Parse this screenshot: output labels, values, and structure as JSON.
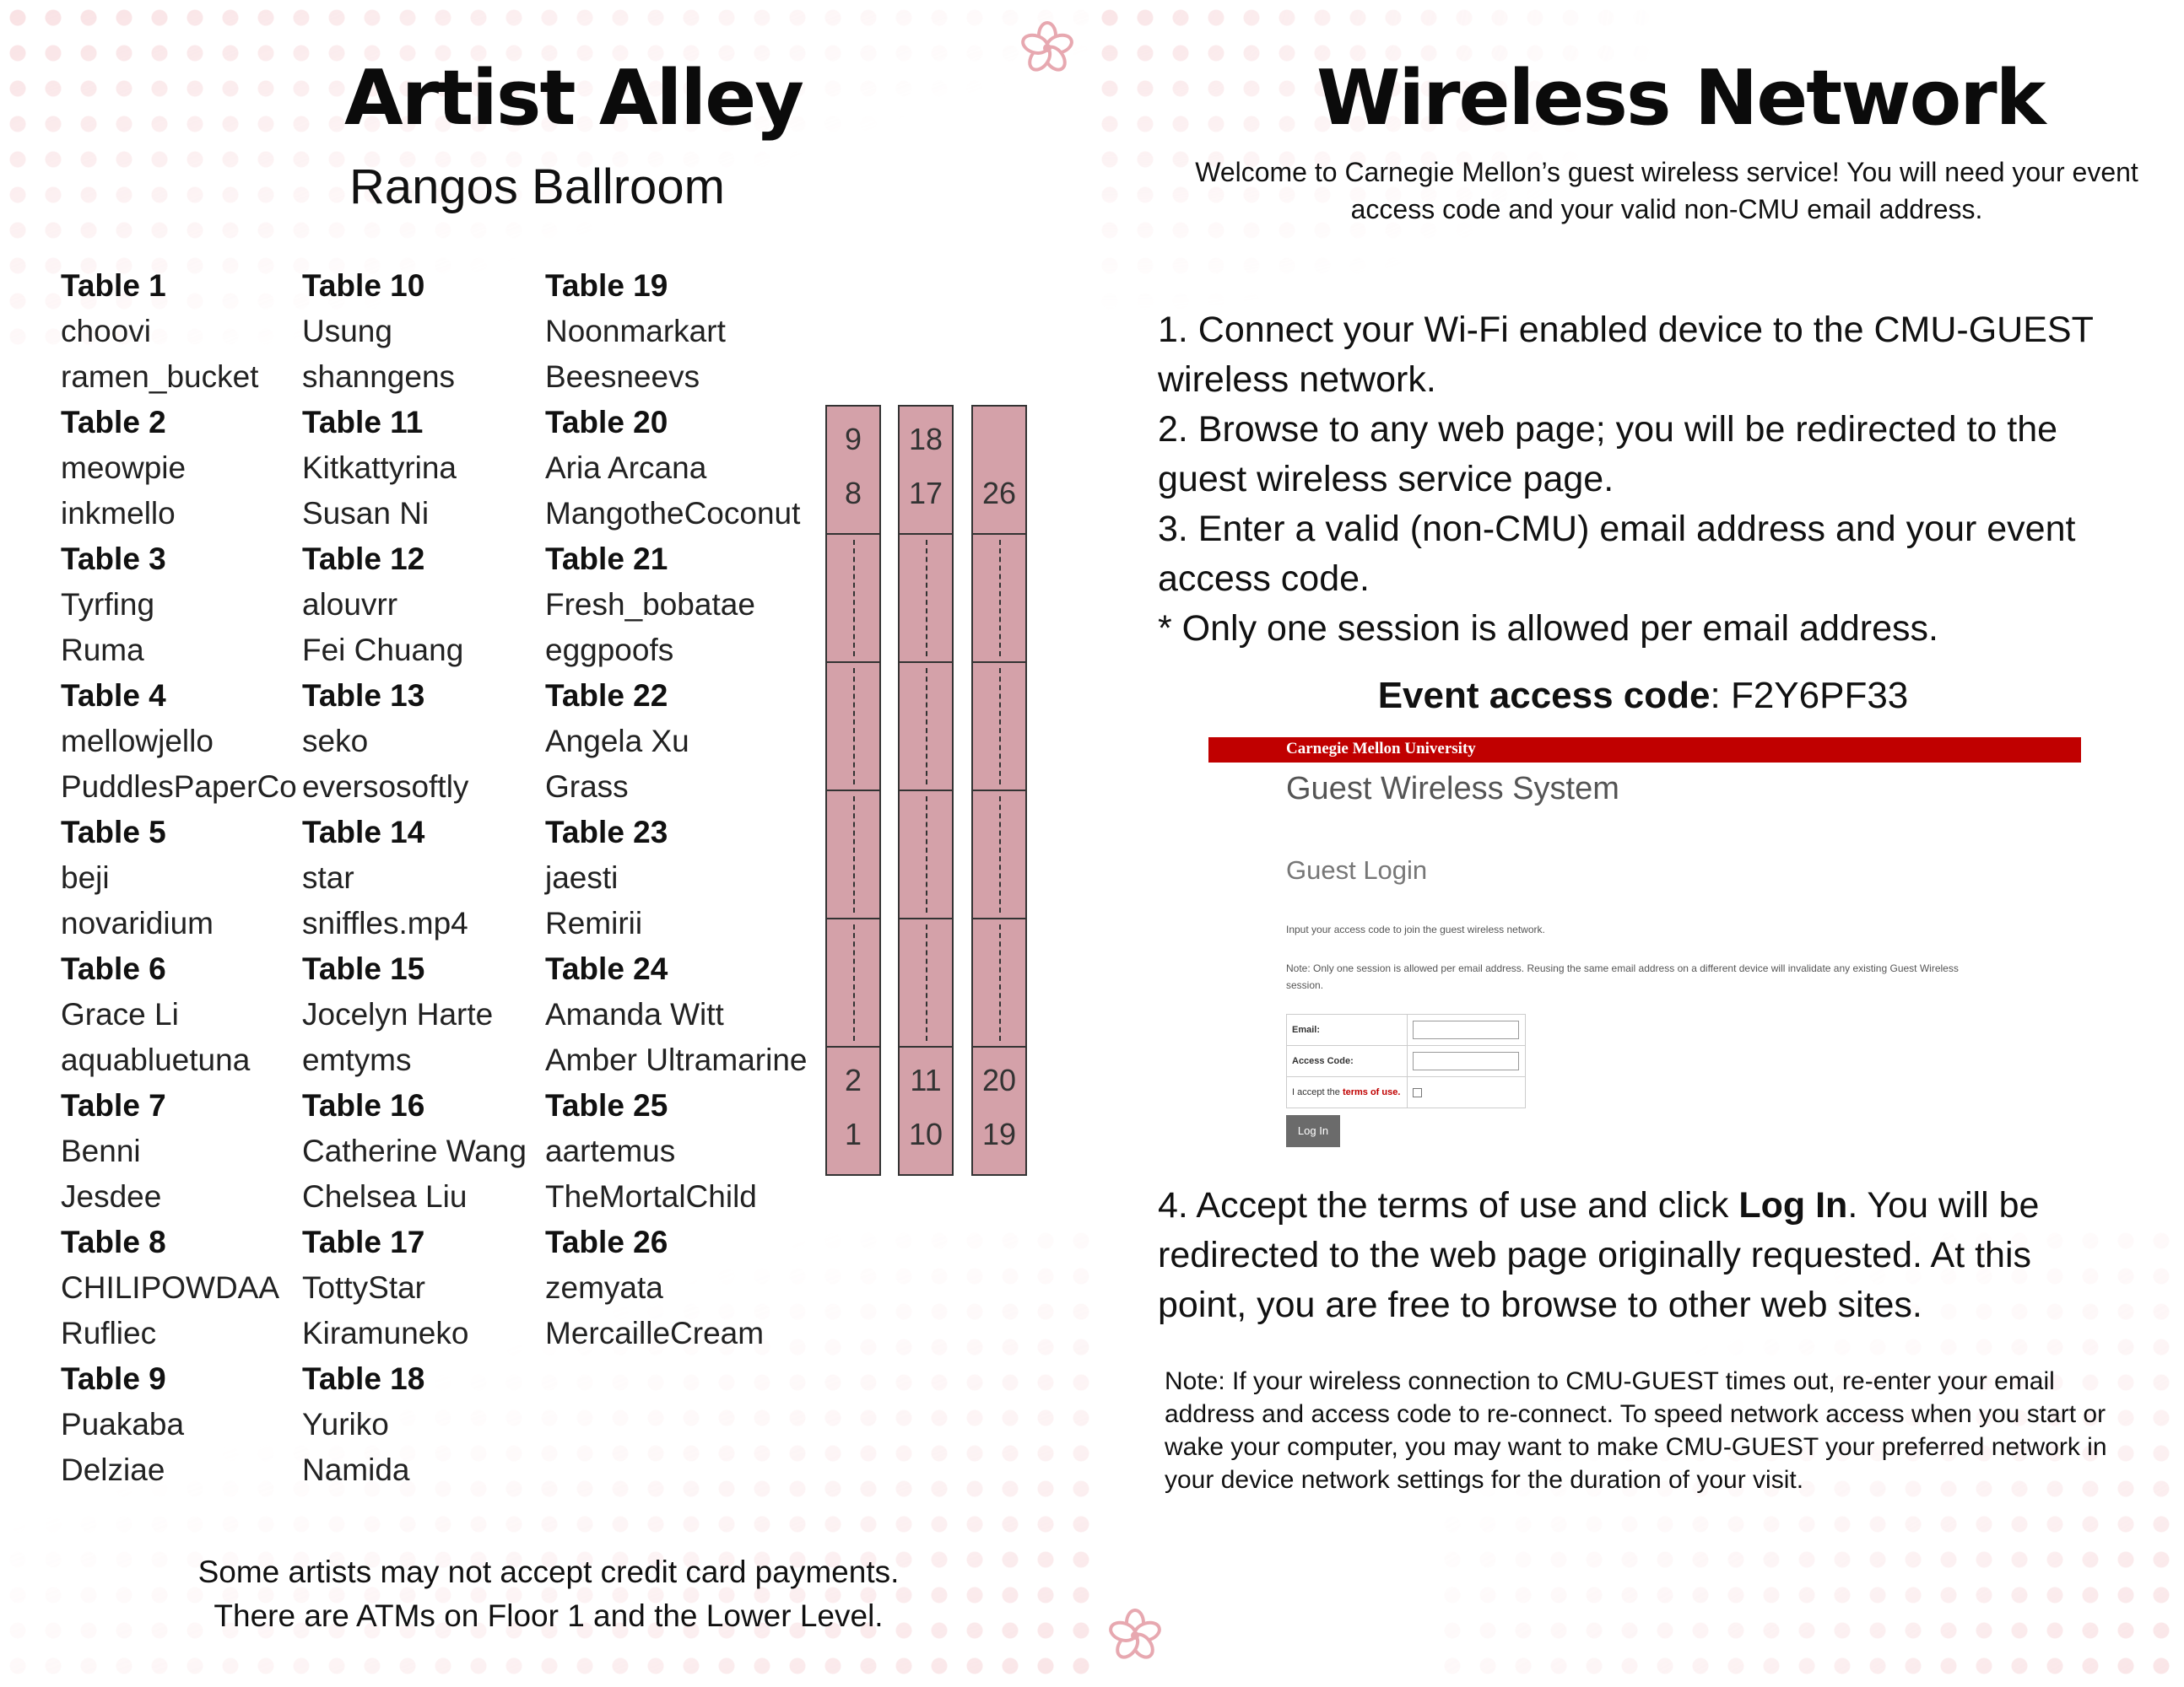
{
  "left": {
    "title": "Artist Alley",
    "subtitle": "Rangos Ballroom",
    "columns": [
      [
        {
          "label": "Table 1",
          "head": true
        },
        {
          "label": "choovi"
        },
        {
          "label": "ramen_bucket"
        },
        {
          "label": "Table 2",
          "head": true
        },
        {
          "label": "meowpie"
        },
        {
          "label": "inkmello"
        },
        {
          "label": "Table 3",
          "head": true
        },
        {
          "label": "Tyrfing"
        },
        {
          "label": "Ruma"
        },
        {
          "label": "Table 4",
          "head": true
        },
        {
          "label": "mellowjello"
        },
        {
          "label": "PuddlesPaperCo"
        },
        {
          "label": "Table 5",
          "head": true
        },
        {
          "label": "beji"
        },
        {
          "label": "novaridium"
        },
        {
          "label": "Table 6",
          "head": true
        },
        {
          "label": "Grace Li"
        },
        {
          "label": "aquabluetuna"
        },
        {
          "label": "Table 7",
          "head": true
        },
        {
          "label": "Benni"
        },
        {
          "label": "Jesdee"
        },
        {
          "label": "Table 8",
          "head": true
        },
        {
          "label": "CHILIPOWDAA"
        },
        {
          "label": "Rufliec"
        },
        {
          "label": "Table 9",
          "head": true
        },
        {
          "label": "Puakaba"
        },
        {
          "label": "Delziae"
        }
      ],
      [
        {
          "label": "Table 10",
          "head": true
        },
        {
          "label": "Usung"
        },
        {
          "label": "shanngens"
        },
        {
          "label": "Table 11",
          "head": true
        },
        {
          "label": "Kitkattyrina"
        },
        {
          "label": "Susan Ni"
        },
        {
          "label": "Table 12",
          "head": true
        },
        {
          "label": "alouvrr"
        },
        {
          "label": "Fei Chuang"
        },
        {
          "label": "Table 13",
          "head": true
        },
        {
          "label": "seko"
        },
        {
          "label": "eversosoftly"
        },
        {
          "label": "Table 14",
          "head": true
        },
        {
          "label": "star"
        },
        {
          "label": "sniffles.mp4"
        },
        {
          "label": "Table 15",
          "head": true
        },
        {
          "label": "Jocelyn Harte"
        },
        {
          "label": "emtyms"
        },
        {
          "label": "Table 16",
          "head": true
        },
        {
          "label": "Catherine Wang"
        },
        {
          "label": "Chelsea Liu"
        },
        {
          "label": "Table 17",
          "head": true
        },
        {
          "label": "TottyStar"
        },
        {
          "label": "Kiramuneko"
        },
        {
          "label": "Table 18",
          "head": true
        },
        {
          "label": "Yuriko"
        },
        {
          "label": "Namida"
        }
      ],
      [
        {
          "label": "Table 19",
          "head": true
        },
        {
          "label": "Noonmarkart"
        },
        {
          "label": "Beesneevs"
        },
        {
          "label": "Table 20",
          "head": true
        },
        {
          "label": "Aria Arcana"
        },
        {
          "label": "MangotheCoconut"
        },
        {
          "label": "Table 21",
          "head": true
        },
        {
          "label": "Fresh_bobatae"
        },
        {
          "label": "eggpoofs"
        },
        {
          "label": "Table 22",
          "head": true
        },
        {
          "label": "Angela Xu"
        },
        {
          "label": "Grass"
        },
        {
          "label": "Table 23",
          "head": true
        },
        {
          "label": "jaesti"
        },
        {
          "label": "Remirii"
        },
        {
          "label": "Table 24",
          "head": true
        },
        {
          "label": "Amanda Witt"
        },
        {
          "label": "Amber Ultramarine"
        },
        {
          "label": "Table 25",
          "head": true
        },
        {
          "label": "aartemus"
        },
        {
          "label": "TheMortalChild"
        },
        {
          "label": "Table 26",
          "head": true
        },
        {
          "label": "zemyata"
        },
        {
          "label": "MercailleCream"
        }
      ]
    ],
    "map": {
      "color": "#d4a1a9",
      "columns": [
        {
          "top_numbers": [
            "9",
            "8"
          ],
          "bottom_numbers": [
            "2",
            "1"
          ]
        },
        {
          "top_numbers": [
            "18",
            "17"
          ],
          "bottom_numbers": [
            "11",
            "10"
          ]
        },
        {
          "top_numbers": [
            "",
            "26"
          ],
          "bottom_numbers": [
            "20",
            "19"
          ]
        }
      ]
    },
    "note_line1": "Some artists may not accept credit card payments.",
    "note_line2": "There are ATMs on Floor 1 and the Lower Level."
  },
  "right": {
    "title": "Wireless Network",
    "welcome": "Welcome to Carnegie Mellon’s guest wireless service! You will need your event access code and your valid non-CMU email address.",
    "step1": "1. Connect your Wi-Fi enabled device to the CMU-GUEST wireless network.",
    "step2": "2. Browse to any web page; you will be redirected to the guest wireless service page.",
    "step3": "3. Enter a valid (non-CMU) email address and your event access code.",
    "step_note": "* Only one session is allowed per email address.",
    "code_label": "Event access code",
    "code_value": ": F2Y6PF33",
    "screenshot": {
      "bar_text": "Carnegie Mellon University",
      "bar_color": "#c00000",
      "heading": "Guest Wireless System",
      "subheading": "Guest Login",
      "instructions": "Input your access code to join the guest wireless network.",
      "note": "Note: Only one session is allowed per email address. Reusing the same email address on a different device will invalidate any existing Guest Wireless session.",
      "email_label": "Email:",
      "access_label": "Access Code:",
      "accept_prefix": "I accept the ",
      "terms_link": "terms of use.",
      "login_button": "Log In"
    },
    "step4_prefix": "4. Accept the terms of use and click ",
    "step4_bold": "Log In",
    "step4_suffix": ". You will be redirected to the web page originally requested. At this point, you are free to browse to other web sites.",
    "note": "Note: If your wireless connection to CMU-GUEST times out, re-enter your email address and access code to re-connect. To speed network access when you start or wake your computer, you may want to make CMU-GUEST your preferred network in your device network settings for the duration of your visit."
  },
  "accent_pink": "#f4c9cd",
  "icons": [
    "cherry-blossom-icon"
  ]
}
